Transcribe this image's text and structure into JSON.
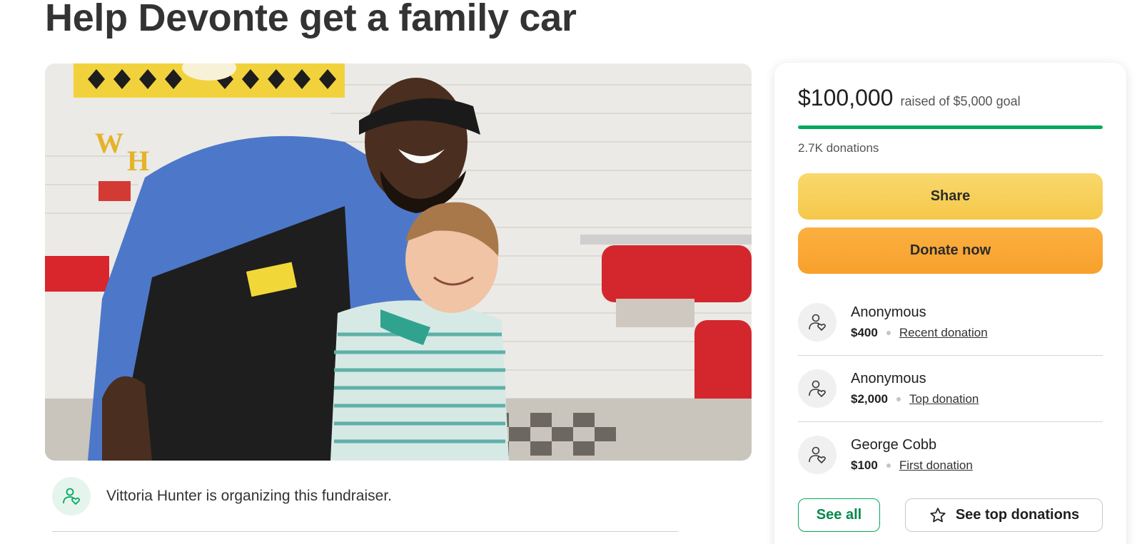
{
  "campaign": {
    "title": "Help Devonte get a family car",
    "organizer_text": "Vittoria Hunter is organizing this fundraiser."
  },
  "progress": {
    "raised": "$100,000",
    "goal_text": "raised of $5,000 goal",
    "fill_fraction": 1.0,
    "donations": "2.7K donations"
  },
  "actions": {
    "share_label": "Share",
    "donate_label": "Donate now"
  },
  "donors": [
    {
      "name": "Anonymous",
      "amount": "$400",
      "tag": "Recent donation"
    },
    {
      "name": "Anonymous",
      "amount": "$2,000",
      "tag": "Top donation"
    },
    {
      "name": "George Cobb",
      "amount": "$100",
      "tag": "First donation"
    }
  ],
  "footer_buttons": {
    "see_all": "See all",
    "see_top": "See top donations"
  },
  "icons": {
    "organizer": "user-heart-icon",
    "donor": "user-heart-icon",
    "star": "star-icon"
  },
  "colors": {
    "brand_green": "#02a95c",
    "share_yellow": "#f5c84a",
    "donate_orange": "#f8a02c"
  }
}
